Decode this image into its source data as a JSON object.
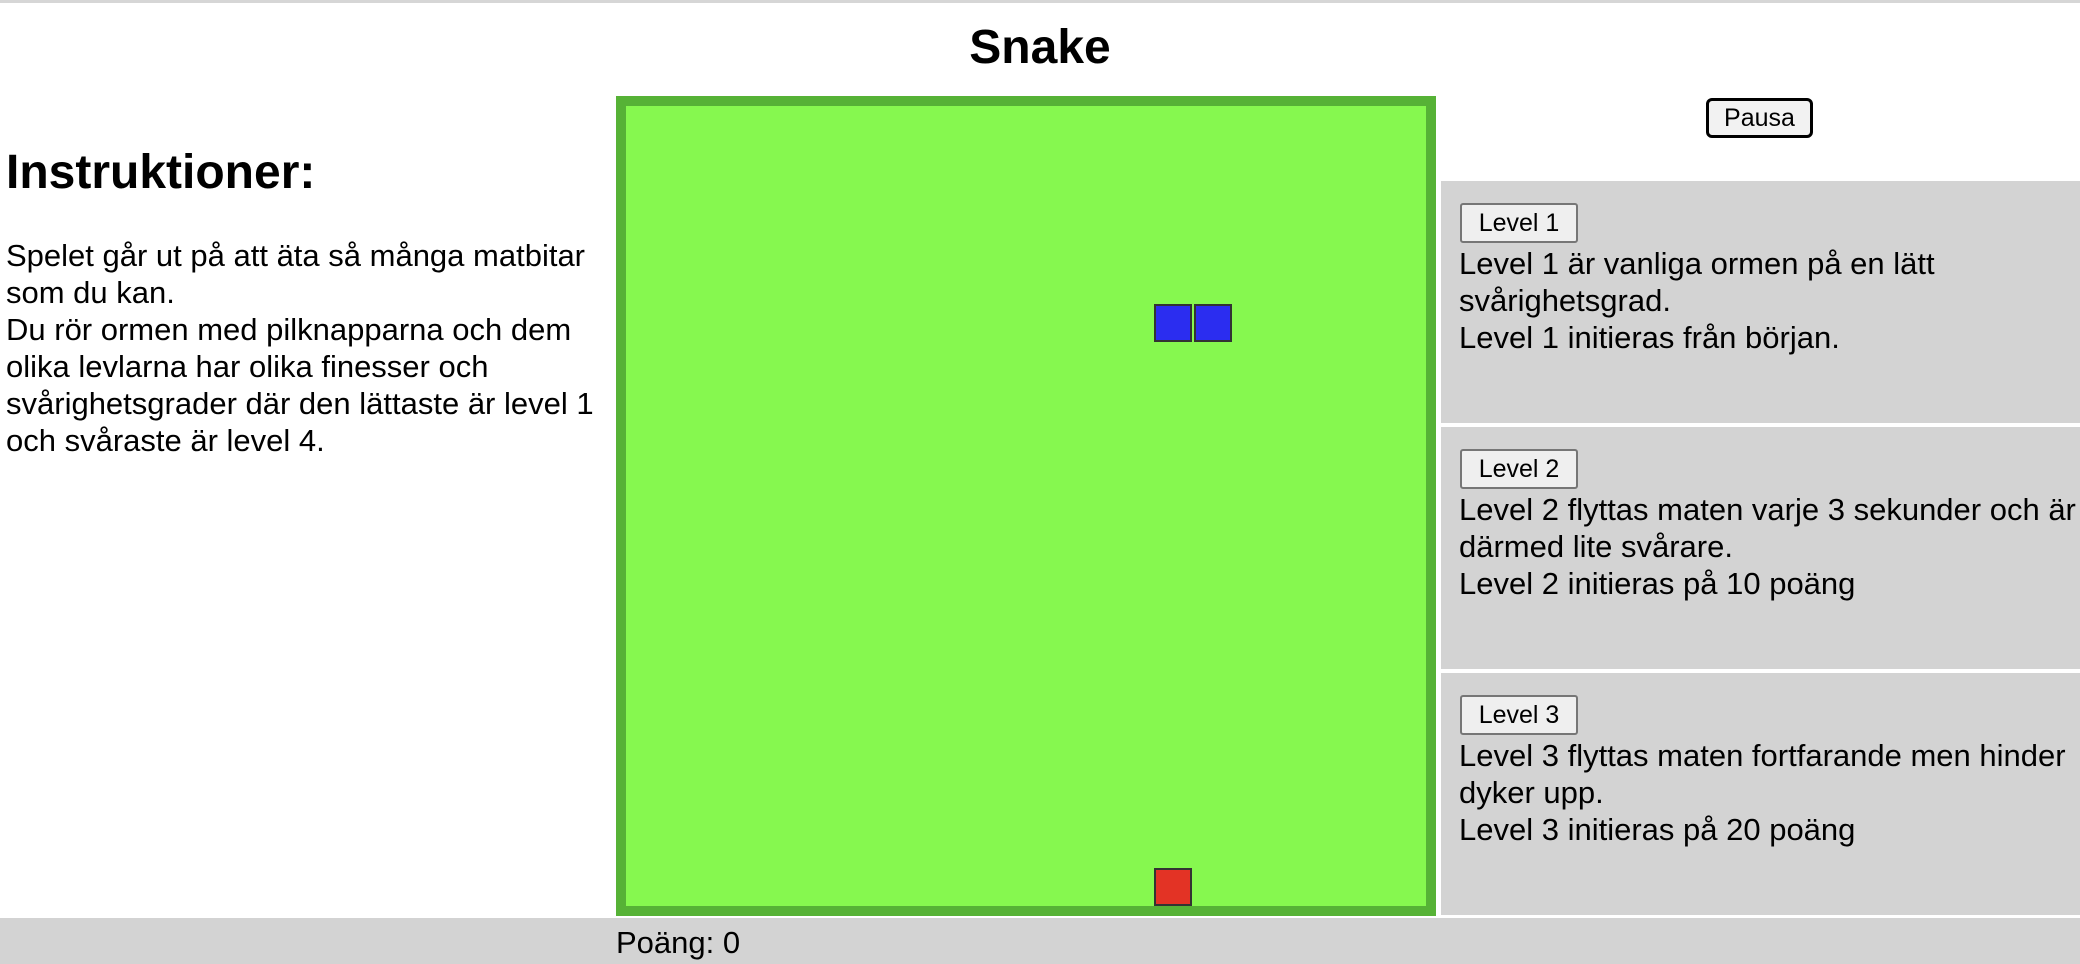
{
  "title": "Snake",
  "instructions": {
    "heading": "Instruktioner:",
    "line1": "Spelet går ut på att äta så många matbitar som du kan.",
    "line2": "Du rör ormen med pilknapparna och dem olika levlarna har olika finesser och svårighetsgrader där den lättaste är level 1 och svåraste är level 4."
  },
  "controls": {
    "pause_label": "Pausa"
  },
  "levels": [
    {
      "button": "Level 1",
      "desc": "Level 1 är vanliga ormen på en lätt svårighetsgrad.",
      "init": "Level 1 initieras från början."
    },
    {
      "button": "Level 2",
      "desc": "Level 2 flyttas maten varje 3 sekunder och är därmed lite svårare.",
      "init": "Level 2 initieras på 10 poäng"
    },
    {
      "button": "Level 3",
      "desc": "Level 3 flyttas maten fortfarande men hinder dyker upp.",
      "init": "Level 3 initieras på 20 poäng"
    }
  ],
  "footer": {
    "score": "Poäng: 0"
  },
  "colors": {
    "board_bg": "#86f84f",
    "board_border": "#56b236",
    "snake": "#2b2df0",
    "food": "#e33325",
    "panel_bg": "#d3d3d3"
  }
}
